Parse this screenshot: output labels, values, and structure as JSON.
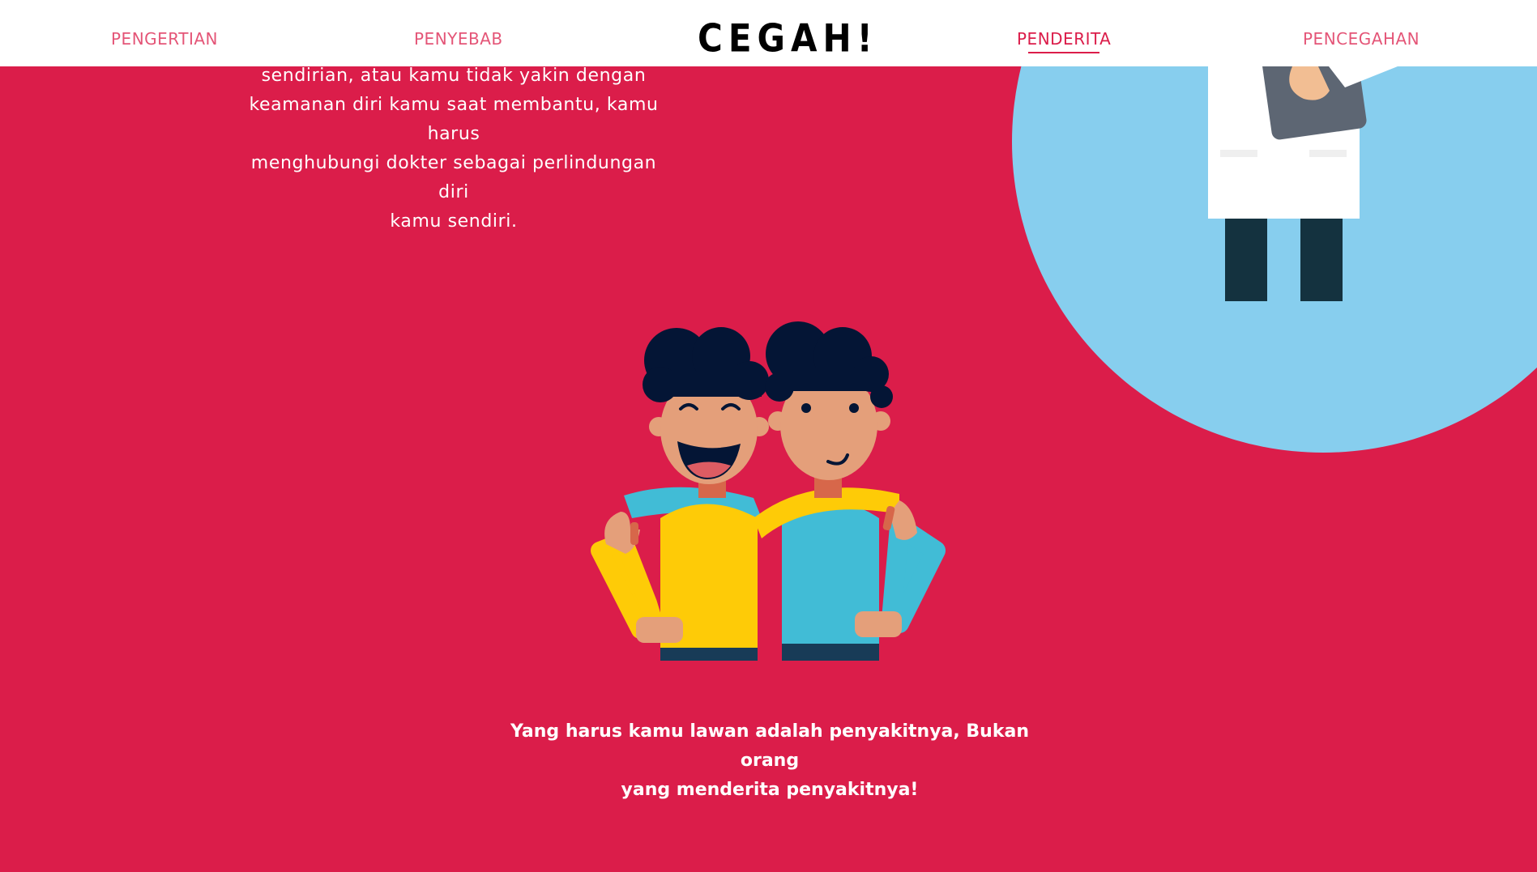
{
  "nav": {
    "logo": "CEGAH!",
    "items": [
      {
        "label": "PENGERTIAN"
      },
      {
        "label": "PENYEBAB"
      },
      {
        "label": "PENDERITA"
      },
      {
        "label": "PENCEGAHAN"
      }
    ],
    "active_index": 2
  },
  "intro": {
    "lines": [
      "sendirian, atau kamu tidak yakin dengan",
      "keamanan diri kamu saat membantu, kamu harus",
      "menghubungi dokter sebagai perlindungan diri",
      "kamu sendiri."
    ]
  },
  "closing": {
    "lines": [
      "Yang harus kamu lawan adalah penyakitnya, Bukan orang",
      "yang menderita penyakitnya!"
    ]
  },
  "colors": {
    "background": "#DB1D4A",
    "navbar": "#FFFFFF",
    "accent": "#DB1D4A",
    "circle": "#87CEEE",
    "hair": "#041535",
    "skin": "#E49F7A",
    "yellow_shirt": "#FECB07",
    "blue_shirt": "#41BCD6",
    "pants": "#183B57"
  }
}
